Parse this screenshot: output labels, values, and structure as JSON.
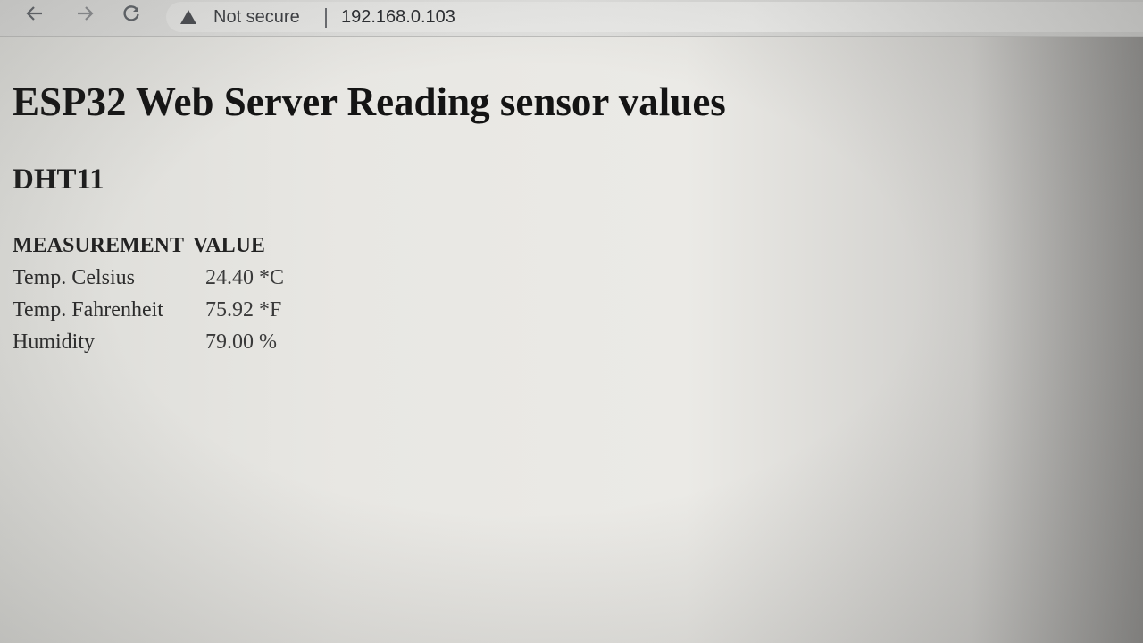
{
  "browser": {
    "security_label": "Not secure",
    "url": "192.168.0.103",
    "back_icon": "arrow-left-icon",
    "forward_icon": "arrow-right-icon",
    "reload_icon": "reload-icon",
    "warning_icon": "warning-triangle-icon"
  },
  "page": {
    "title": "ESP32 Web Server Reading sensor values",
    "sensor_heading": "DHT11",
    "table": {
      "headers": [
        "MEASUREMENT",
        "VALUE"
      ],
      "rows": [
        {
          "measurement": "Temp. Celsius",
          "value": "24.40 *C"
        },
        {
          "measurement": "Temp. Fahrenheit",
          "value": "75.92 *F"
        },
        {
          "measurement": "Humidity",
          "value": "79.00 %"
        }
      ]
    }
  }
}
